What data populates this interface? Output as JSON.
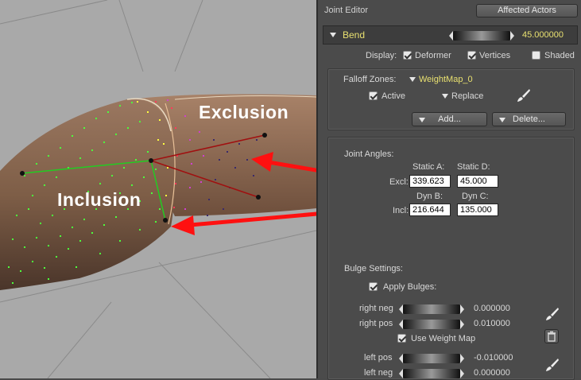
{
  "viewport": {
    "exclusion_label": "Exclusion",
    "inclusion_label": "Inclusion",
    "colors": {
      "skin": "#8a6a52",
      "inclusion_dots": "#4cff3c",
      "exclusion_dots": "#d040d0",
      "arrow": "#ff2020",
      "bone_green": "#22cc22",
      "bone_red": "#a01010"
    }
  },
  "panel": {
    "title": "Joint Editor",
    "affected_actors_label": "Affected Actors",
    "bend": {
      "label": "Bend",
      "value": "45.000000"
    },
    "display": {
      "label": "Display:",
      "options": [
        {
          "label": "Deformer",
          "checked": true
        },
        {
          "label": "Vertices",
          "checked": true
        },
        {
          "label": "Shaded",
          "checked": false
        }
      ]
    },
    "falloff": {
      "label": "Falloff Zones:",
      "weightmap": "WeightMap_0",
      "active_label": "Active",
      "active_checked": true,
      "replace_label": "Replace",
      "add_label": "Add...",
      "delete_label": "Delete..."
    },
    "joint_angles": {
      "label": "Joint Angles:",
      "static_a_label": "Static A:",
      "static_d_label": "Static D:",
      "excl_label": "Excl:",
      "excl_a": "339.623",
      "excl_d": "45.000",
      "dyn_b_label": "Dyn B:",
      "dyn_c_label": "Dyn C:",
      "incl_label": "Incl:",
      "incl_b": "216.644",
      "incl_c": "135.000"
    },
    "bulge": {
      "label": "Bulge Settings:",
      "apply_label": "Apply Bulges:",
      "apply_checked": true,
      "right_neg_label": "right neg",
      "right_neg_value": "0.000000",
      "right_pos_label": "right pos",
      "right_pos_value": "0.010000",
      "use_weight_map_label": "Use Weight Map",
      "use_weight_map_checked": true,
      "left_pos_label": "left pos",
      "left_pos_value": "-0.010000",
      "left_neg_label": "left neg",
      "left_neg_value": "0.000000"
    }
  }
}
